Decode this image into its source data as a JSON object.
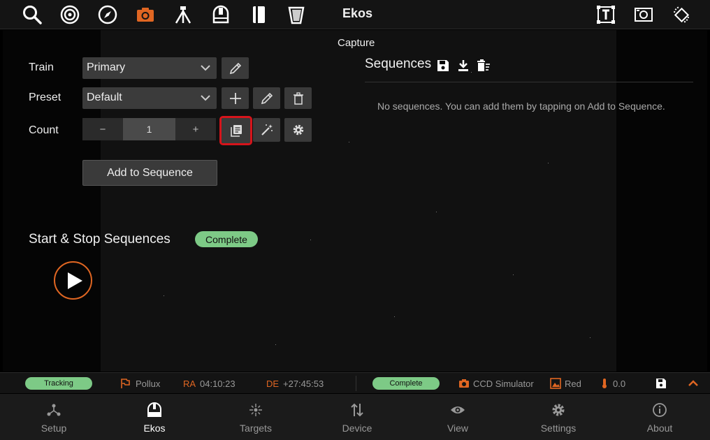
{
  "header": {
    "title": "Ekos"
  },
  "module": {
    "title": "Capture"
  },
  "form": {
    "train_label": "Train",
    "train_value": "Primary",
    "preset_label": "Preset",
    "preset_value": "Default",
    "count_label": "Count",
    "count_minus": "−",
    "count_value": "1",
    "count_plus": "+",
    "add_button": "Add to Sequence"
  },
  "control": {
    "title": "Start & Stop Sequences",
    "status": "Complete"
  },
  "sequences": {
    "title": "Sequences",
    "empty_text": "No sequences. You can add them by tapping on Add to Sequence."
  },
  "statusbar": {
    "mount_status": "Tracking",
    "target": "Pollux",
    "ra_label": "RA",
    "ra_value": "04:10:23",
    "de_label": "DE",
    "de_value": "+27:45:53",
    "capture_status": "Complete",
    "camera": "CCD Simulator",
    "filter": "Red",
    "temperature": "0.0"
  },
  "nav": [
    {
      "label": "Setup",
      "icon": "setup-icon"
    },
    {
      "label": "Ekos",
      "icon": "ekos-dome-icon"
    },
    {
      "label": "Targets",
      "icon": "targets-icon"
    },
    {
      "label": "Device",
      "icon": "device-icon"
    },
    {
      "label": "View",
      "icon": "eye-icon"
    },
    {
      "label": "Settings",
      "icon": "gear-icon"
    },
    {
      "label": "About",
      "icon": "info-icon"
    }
  ],
  "colors": {
    "accent": "#e06622",
    "success": "#7dca86",
    "highlight": "#d6141b"
  }
}
